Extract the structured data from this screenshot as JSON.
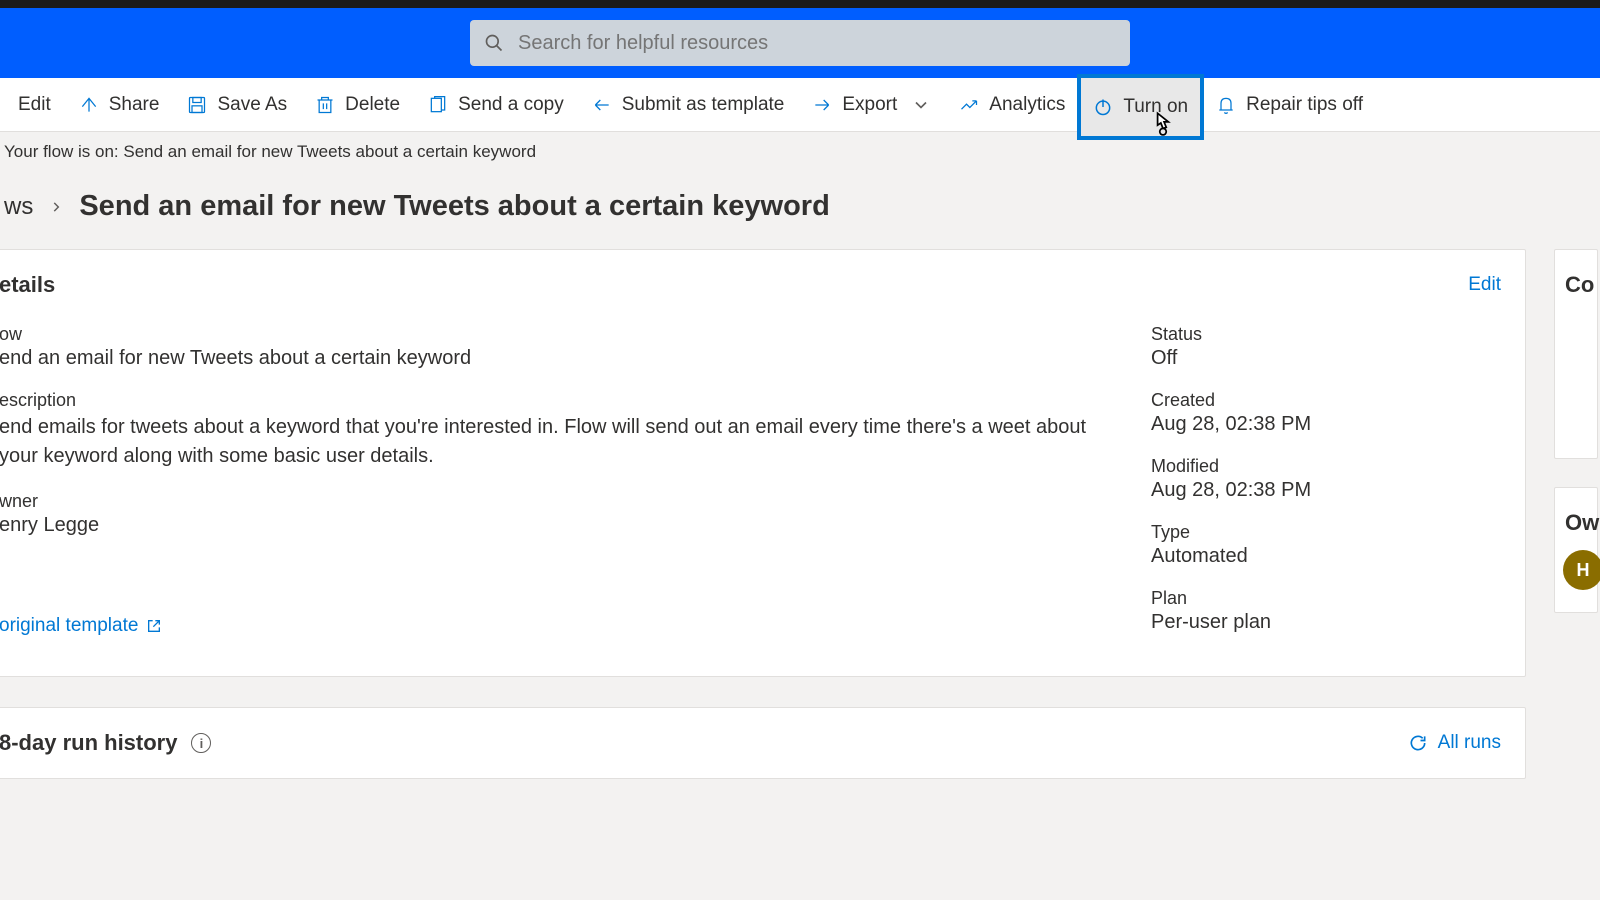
{
  "search": {
    "placeholder": "Search for helpful resources"
  },
  "toolbar": {
    "edit": "Edit",
    "share": "Share",
    "save_as": "Save As",
    "delete": "Delete",
    "send_copy": "Send a copy",
    "submit_template": "Submit as template",
    "export": "Export",
    "analytics": "Analytics",
    "turn_on": "Turn on",
    "repair_tips": "Repair tips off"
  },
  "status_message": "Your flow is on: Send an email for new Tweets about a certain keyword",
  "breadcrumb": {
    "parent": "ws",
    "title": "Send an email for new Tweets about a certain keyword"
  },
  "details": {
    "heading": "etails",
    "edit_label": "Edit",
    "flow_label": "ow",
    "flow_value": "end an email for new Tweets about a certain keyword",
    "description_label": "escription",
    "description_value": "end emails for tweets about a keyword that you're interested in. Flow will send out an email every time there's a weet about your keyword along with some basic user details.",
    "owner_label": "wner",
    "owner_value": "enry Legge",
    "status_label": "Status",
    "status_value": "Off",
    "created_label": "Created",
    "created_value": "Aug 28, 02:38 PM",
    "modified_label": "Modified",
    "modified_value": "Aug 28, 02:38 PM",
    "type_label": "Type",
    "type_value": "Automated",
    "plan_label": "Plan",
    "plan_value": "Per-user plan",
    "template_link": "original template"
  },
  "side": {
    "connections_label": "Co",
    "owners_label": "Ow",
    "avatar_initial": "H"
  },
  "run_history": {
    "title": "8-day run history",
    "all_runs": "All runs"
  }
}
